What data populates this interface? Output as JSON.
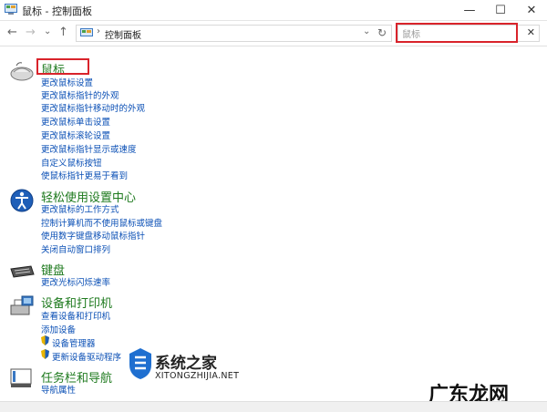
{
  "window": {
    "title": "鼠标 - 控制面板",
    "minimize": "—",
    "maximize": "☐",
    "close": "✕"
  },
  "toolbar": {
    "back": "←",
    "forward": "→",
    "dropdown": "⌄",
    "up": "↑",
    "breadcrumb_sep": "›",
    "breadcrumb": "控制面板",
    "addr_dropdown": "⌄",
    "refresh": "↻"
  },
  "search": {
    "value": "鼠标",
    "clear": "✕"
  },
  "sections": {
    "mouse": {
      "heading": "鼠标",
      "links": [
        "更改鼠标设置",
        "更改鼠标指针的外观",
        "更改鼠标指针移动时的外观",
        "更改鼠标单击设置",
        "更改鼠标滚轮设置",
        "更改鼠标指针显示或速度",
        "自定义鼠标按钮",
        "使鼠标指针更易于看到"
      ]
    },
    "ease": {
      "heading": "轻松使用设置中心",
      "links": [
        "更改鼠标的工作方式",
        "控制计算机而不使用鼠标或键盘",
        "使用数字键盘移动鼠标指针",
        "关闭自动窗口排列"
      ]
    },
    "keyboard": {
      "heading": "键盘",
      "links": [
        "更改光标闪烁速率"
      ]
    },
    "devices": {
      "heading": "设备和打印机",
      "links": [
        "查看设备和打印机",
        "添加设备",
        "设备管理器",
        "更新设备驱动程序"
      ]
    },
    "taskbar": {
      "heading": "任务栏和导航",
      "links": [
        "导航属性"
      ]
    }
  },
  "watermark": {
    "title": "系统之家",
    "subtitle": "XITONGZHIJIA.NET",
    "brand": "广东龙网"
  },
  "colors": {
    "highlight": "#d9232b",
    "heading": "#1e7a1e",
    "link": "#0a4fb5"
  }
}
